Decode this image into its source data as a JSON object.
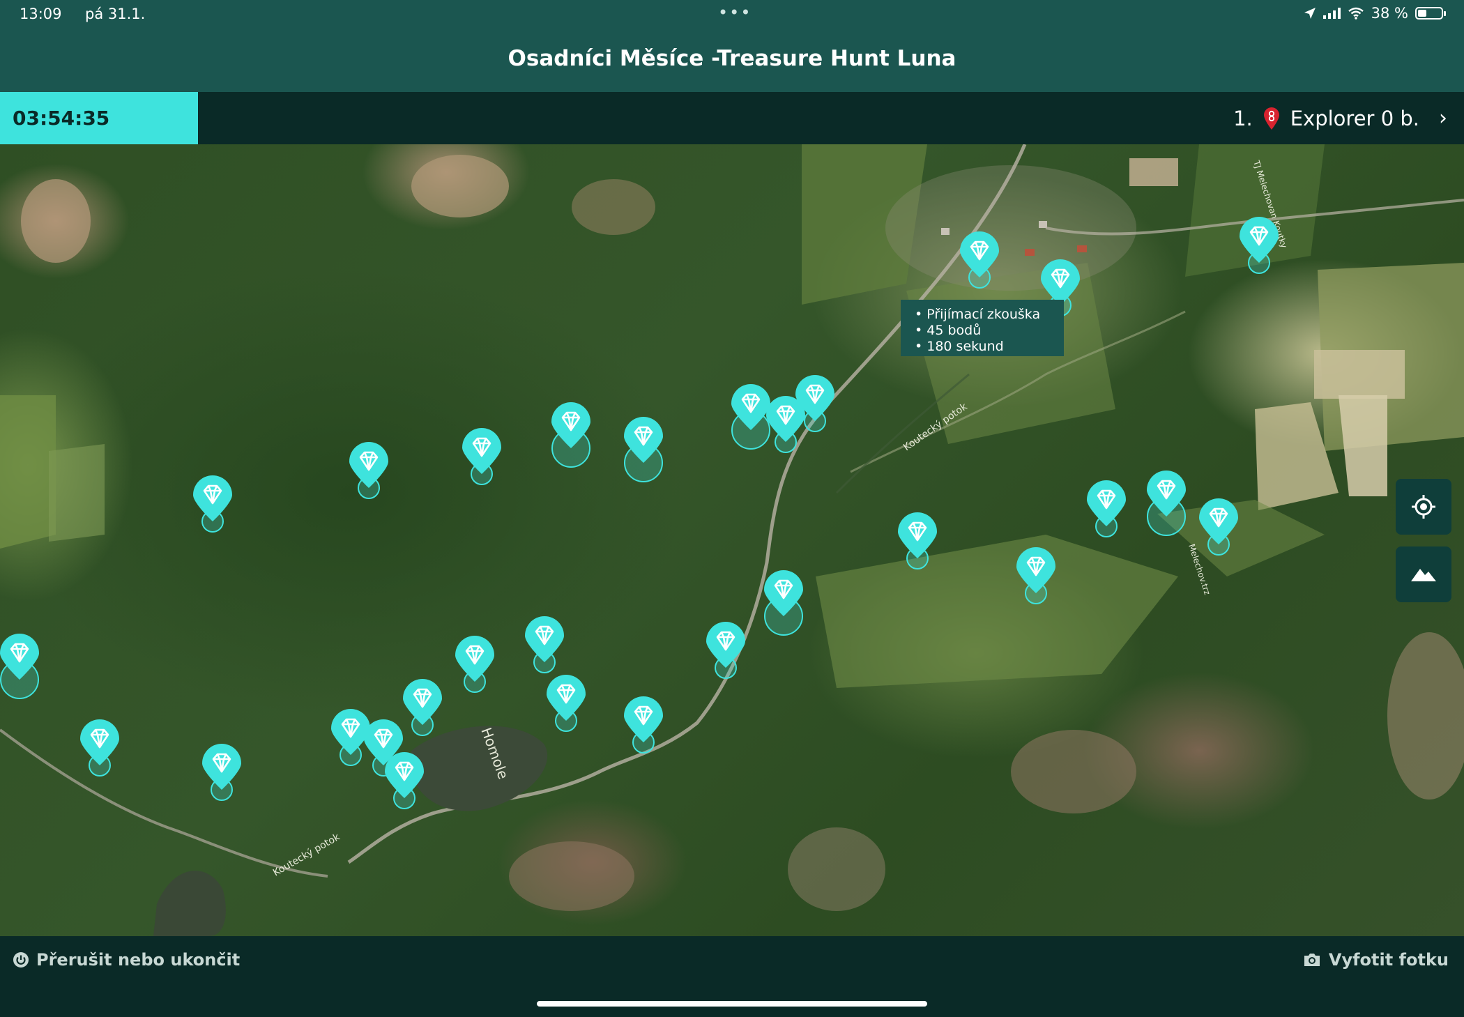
{
  "status": {
    "time": "13:09",
    "date": "pá 31.1.",
    "battery": "38 %",
    "more_dots": "•••"
  },
  "header": {
    "title": "Osadníci Měsíce -Treasure Hunt Luna"
  },
  "infobar": {
    "timer": "03:54:35",
    "rank": "1.",
    "player": "Explorer 0 b.",
    "chevron": "›"
  },
  "map": {
    "callout": {
      "lines": [
        "• Přijímací zkouška",
        "• 45 bodů",
        "• 180 sekund"
      ]
    },
    "marker_icon": "diamond-pin-icon",
    "marker_color": "#3ee3dd"
  },
  "controls": {
    "locate_icon": "locate-icon",
    "map_type_icon": "mountain-icon"
  },
  "footer": {
    "quit_label": "Přerušit nebo ukončit",
    "photo_label": "Vyfotit fotku"
  },
  "colors": {
    "header_bg": "#1b5650",
    "bar_bg": "#0a2a27",
    "accent": "#3ee3dd"
  }
}
